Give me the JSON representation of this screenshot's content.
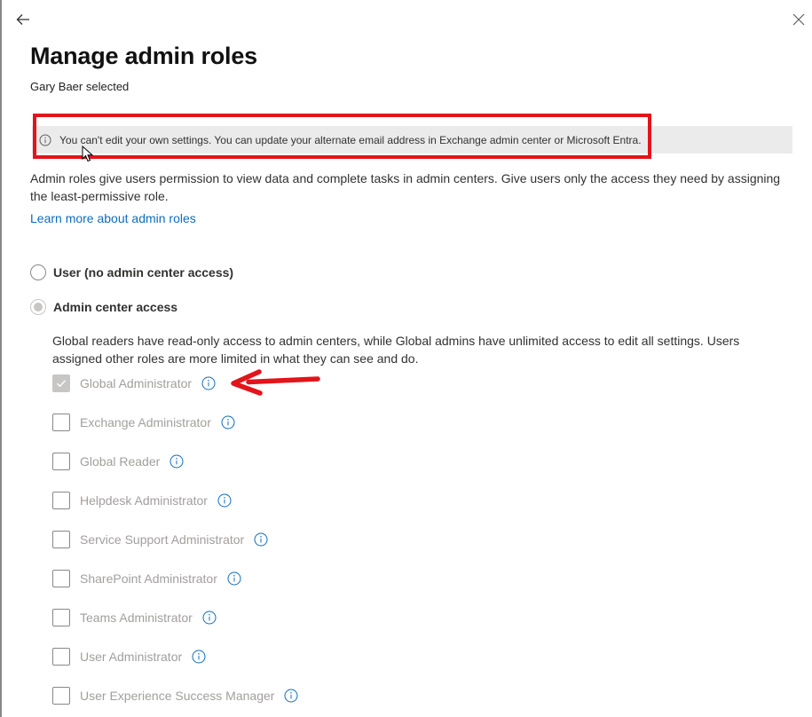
{
  "panel": {
    "title": "Manage admin roles",
    "subtitle": "Gary Baer selected"
  },
  "icons": {
    "back": "back-arrow-icon",
    "close": "close-icon",
    "info": "info-icon"
  },
  "info_bar": {
    "message": "You can't edit your own settings. You can update your alternate email address in Exchange admin center or Microsoft Entra."
  },
  "description": "Admin roles give users permission to view data and complete tasks in admin centers. Give users only the access they need by assigning the least-permissive role.",
  "learn_more_link": "Learn more about admin roles",
  "access_options": [
    {
      "label": "User (no admin center access)",
      "selected": false
    },
    {
      "label": "Admin center access",
      "selected": true
    }
  ],
  "roles_description": "Global readers have read-only access to admin centers, while Global admins have unlimited access to edit all settings. Users assigned other roles are more limited in what they can see and do.",
  "roles": [
    {
      "label": "Global Administrator",
      "checked": true
    },
    {
      "label": "Exchange Administrator",
      "checked": false
    },
    {
      "label": "Global Reader",
      "checked": false
    },
    {
      "label": "Helpdesk Administrator",
      "checked": false
    },
    {
      "label": "Service Support Administrator",
      "checked": false
    },
    {
      "label": "SharePoint Administrator",
      "checked": false
    },
    {
      "label": "Teams Administrator",
      "checked": false
    },
    {
      "label": "User Administrator",
      "checked": false
    },
    {
      "label": "User Experience Success Manager",
      "checked": false
    }
  ],
  "colors": {
    "annotation_red": "#e3141b",
    "link_blue": "#0f6cbd",
    "info_bar_bg": "#ebebeb",
    "disabled_text": "#a19f9d"
  }
}
